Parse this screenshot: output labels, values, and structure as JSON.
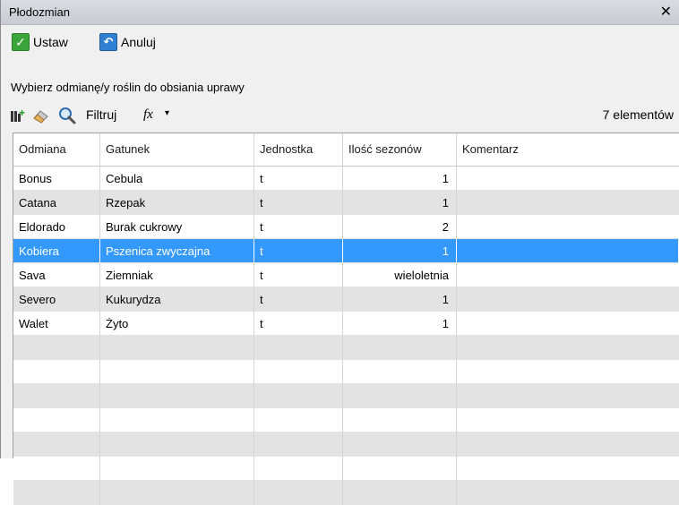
{
  "window": {
    "title": "Płodozmian",
    "close_glyph": "✕"
  },
  "toolbar": {
    "set_label": "Ustaw",
    "cancel_label": "Anuluj"
  },
  "prompt": "Wybierz odmianę/y roślin do obsiania uprawy",
  "filter_bar": {
    "filter_label": "Filtruj",
    "fx_label": "fx",
    "fx_arrow": "▾",
    "count": "7 elementów"
  },
  "icons": [
    "check-icon",
    "undo-icon",
    "add-column-icon",
    "eraser-icon",
    "magnifier-icon",
    "function-icon"
  ],
  "colors": {
    "selection": "#3399ff",
    "alt_row": "#e3e3e3",
    "check_green": "#3aa53a",
    "undo_blue": "#2f7fd3"
  },
  "table": {
    "columns": [
      "Odmiana",
      "Gatunek",
      "Jednostka",
      "Ilość sezonów",
      "Komentarz"
    ],
    "rows": [
      [
        "Bonus",
        "Cebula",
        "t",
        "1",
        ""
      ],
      [
        "Catana",
        "Rzepak",
        "t",
        "1",
        ""
      ],
      [
        "Eldorado",
        "Burak cukrowy",
        "t",
        "2",
        ""
      ],
      [
        "Kobiera",
        "Pszenica zwyczajna",
        "t",
        "1",
        ""
      ],
      [
        "Sava",
        "Ziemniak",
        "t",
        "wieloletnia",
        ""
      ],
      [
        "Severo",
        "Kukurydza",
        "t",
        "1",
        ""
      ],
      [
        "Walet",
        "Żyto",
        "t",
        "1",
        ""
      ]
    ],
    "selected_row": 3
  }
}
